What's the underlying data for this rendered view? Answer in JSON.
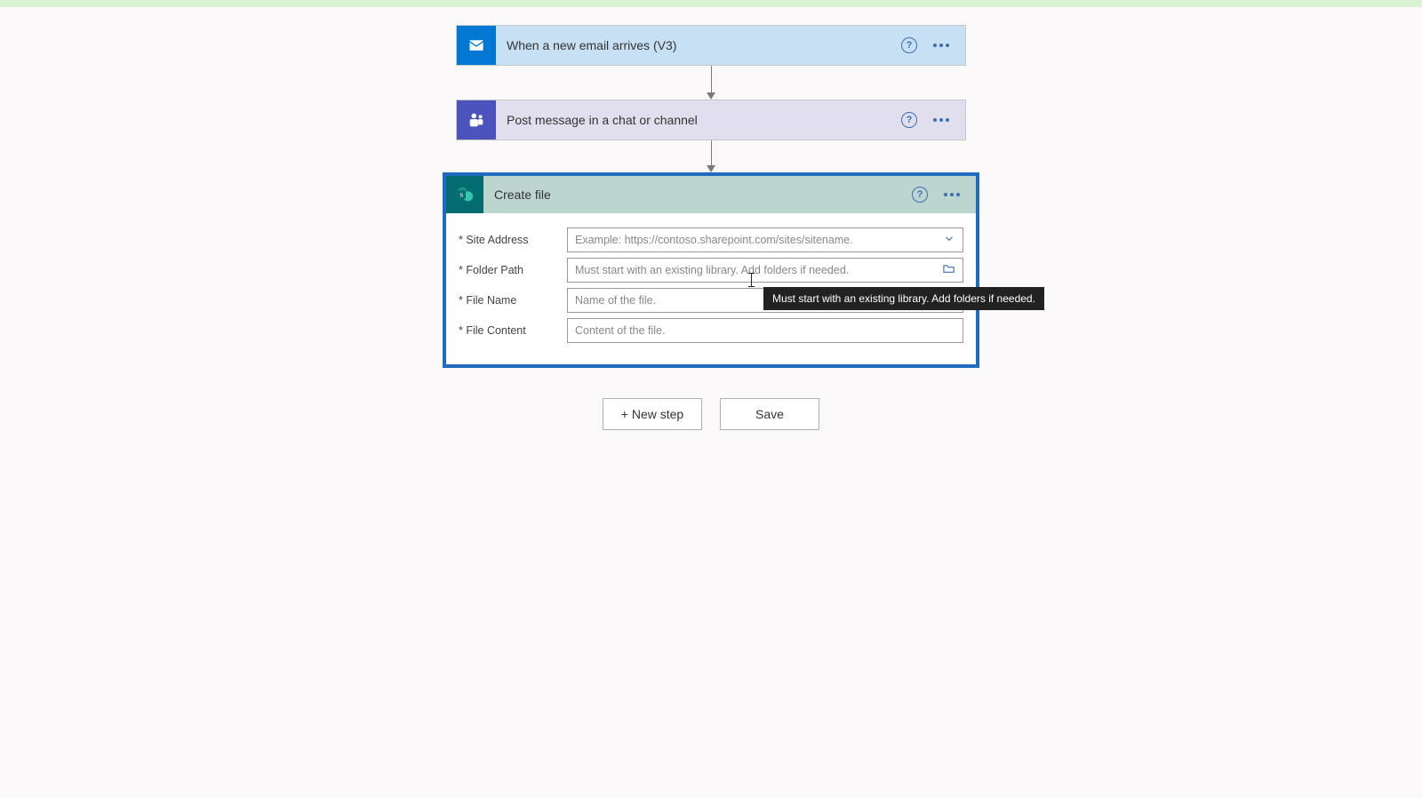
{
  "steps": {
    "outlook": {
      "title": "When a new email arrives (V3)"
    },
    "teams": {
      "title": "Post message in a chat or channel"
    },
    "sharepoint": {
      "title": "Create file",
      "fields": {
        "site_address": {
          "label": "* Site Address",
          "placeholder": "Example: https://contoso.sharepoint.com/sites/sitename."
        },
        "folder_path": {
          "label": "* Folder Path",
          "placeholder": "Must start with an existing library. Add folders if needed."
        },
        "file_name": {
          "label": "* File Name",
          "placeholder": "Name of the file."
        },
        "file_content": {
          "label": "* File Content",
          "placeholder": "Content of the file."
        }
      }
    }
  },
  "tooltip": "Must start with an existing library. Add folders if needed.",
  "footer": {
    "new_step": "+ New step",
    "save": "Save"
  }
}
